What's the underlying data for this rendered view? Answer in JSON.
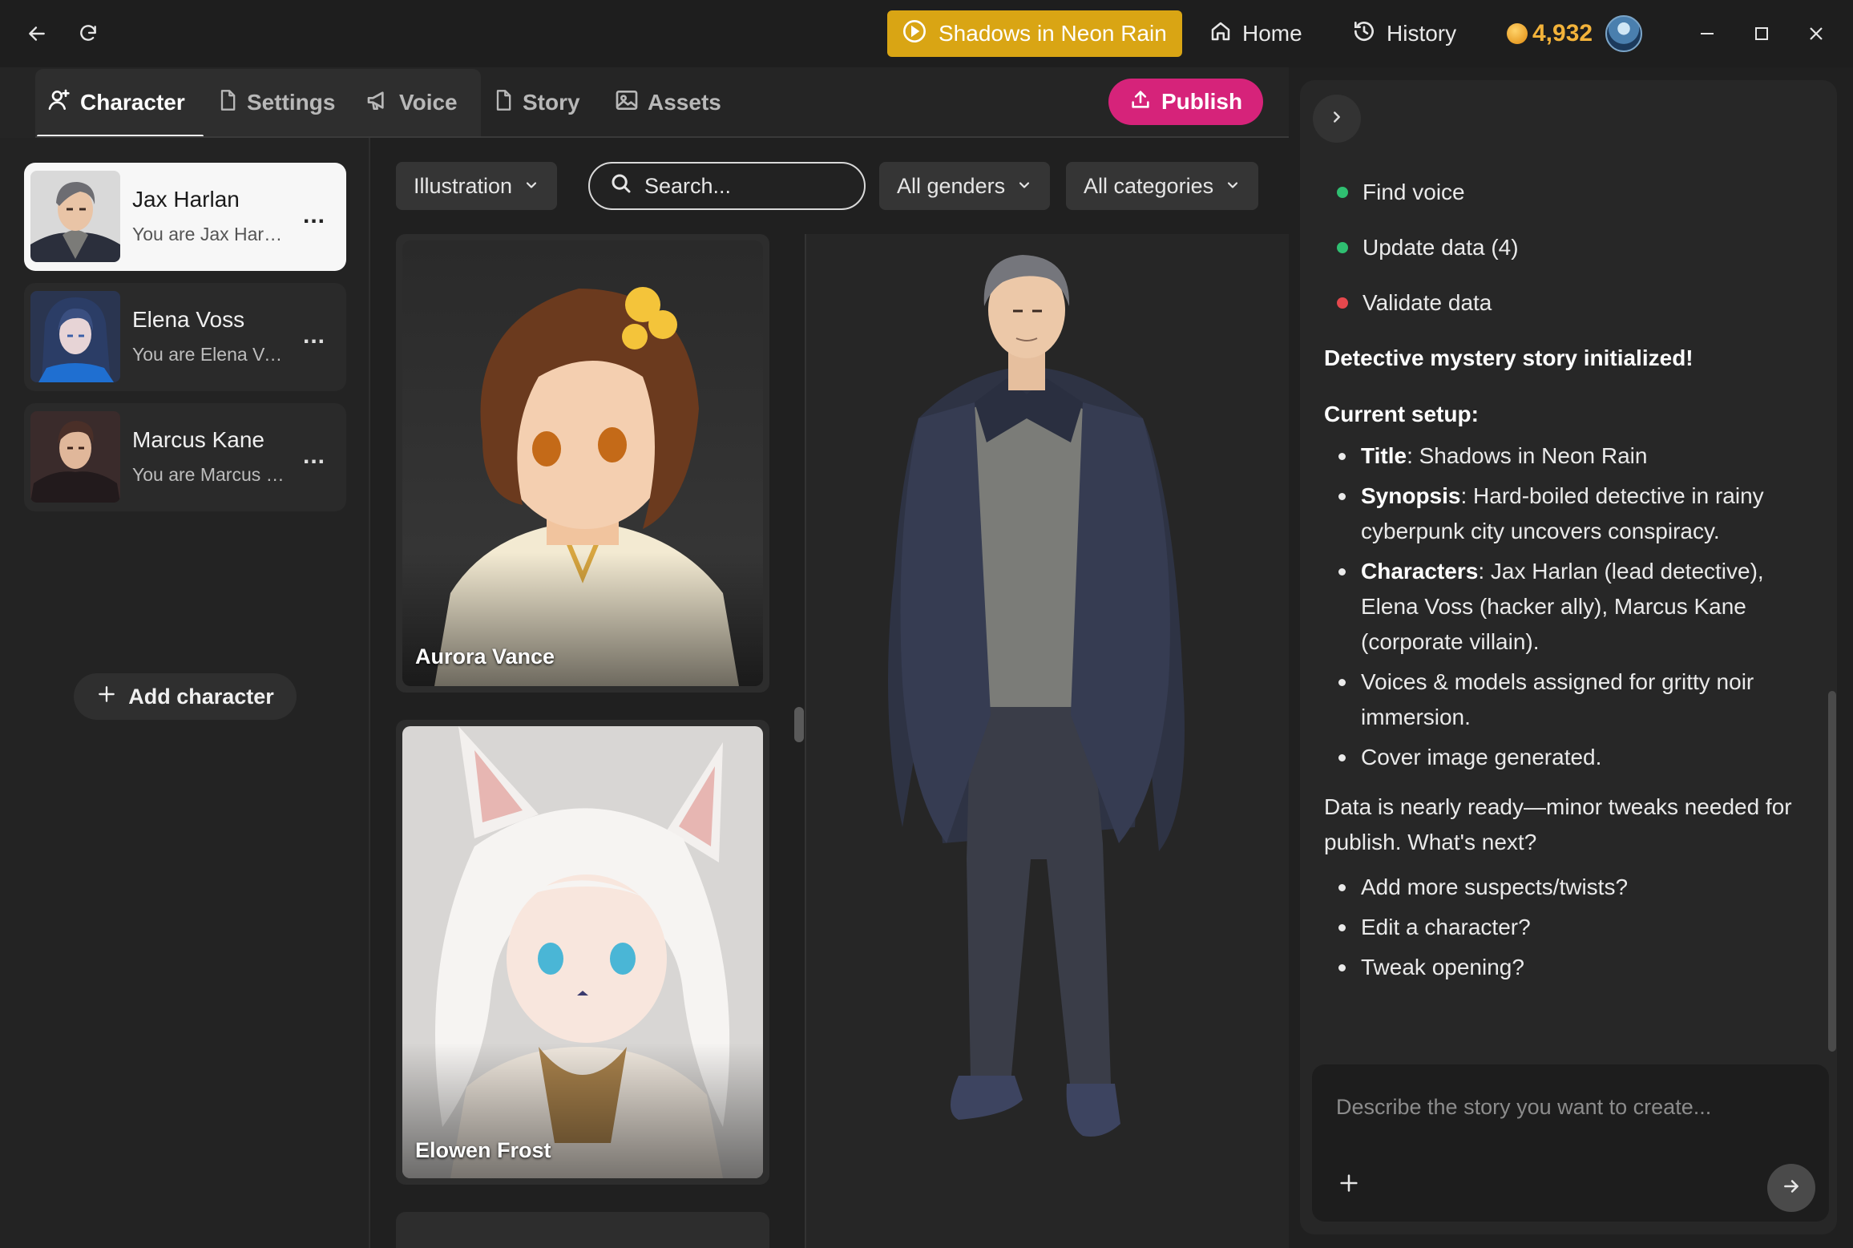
{
  "titlebar": {
    "story_title": "Shadows in Neon Rain",
    "home_label": "Home",
    "history_label": "History",
    "coins": "4,932"
  },
  "tabs": [
    {
      "label": "Character",
      "active": true
    },
    {
      "label": "Settings",
      "active": false
    },
    {
      "label": "Voice",
      "active": false
    },
    {
      "label": "Story",
      "active": false
    },
    {
      "label": "Assets",
      "active": false
    }
  ],
  "publish_label": "Publish",
  "characters": [
    {
      "name": "Jax Harlan",
      "desc": "You are Jax Harlan",
      "active": true
    },
    {
      "name": "Elena Voss",
      "desc": "You are Elena Voss",
      "active": false
    },
    {
      "name": "Marcus Kane",
      "desc": "You are Marcus Kane",
      "active": false
    }
  ],
  "char_more_label": "...",
  "add_character_label": "Add character",
  "filters": {
    "style": "Illustration",
    "search_placeholder": "Search...",
    "gender": "All genders",
    "category": "All categories"
  },
  "gallery": [
    {
      "name": "Aurora Vance"
    },
    {
      "name": "Elowen Frost"
    }
  ],
  "chat": {
    "steps": [
      {
        "label": "Find voice",
        "status": "done",
        "color": "#2fbf71"
      },
      {
        "label": "Update data (4)",
        "status": "done",
        "color": "#2fbf71"
      },
      {
        "label": "Validate data",
        "status": "error",
        "color": "#e5484d"
      }
    ],
    "heading": "Detective mystery story initialized!",
    "setup_heading": "Current setup:",
    "setup": [
      {
        "key": "Title",
        "value": ": Shadows in Neon Rain"
      },
      {
        "key": "Synopsis",
        "value": ": Hard-boiled detective in rainy cyberpunk city uncovers conspiracy."
      },
      {
        "key": "Characters",
        "value": ": Jax Harlan (lead detective), Elena Voss (hacker ally), Marcus Kane (corporate villain)."
      },
      {
        "key": "",
        "value": "Voices & models assigned for gritty noir immersion."
      },
      {
        "key": "",
        "value": "Cover image generated."
      }
    ],
    "summary": "Data is nearly ready—minor tweaks needed for publish. What's next?",
    "next_steps": [
      "Add more suspects/twists?",
      "Edit a character?",
      "Tweak opening?"
    ],
    "input_placeholder": "Describe the story you want to create..."
  },
  "colors": {
    "accent_story": "#d9a514",
    "publish": "#d6237a",
    "coins": "#f3b33a"
  }
}
